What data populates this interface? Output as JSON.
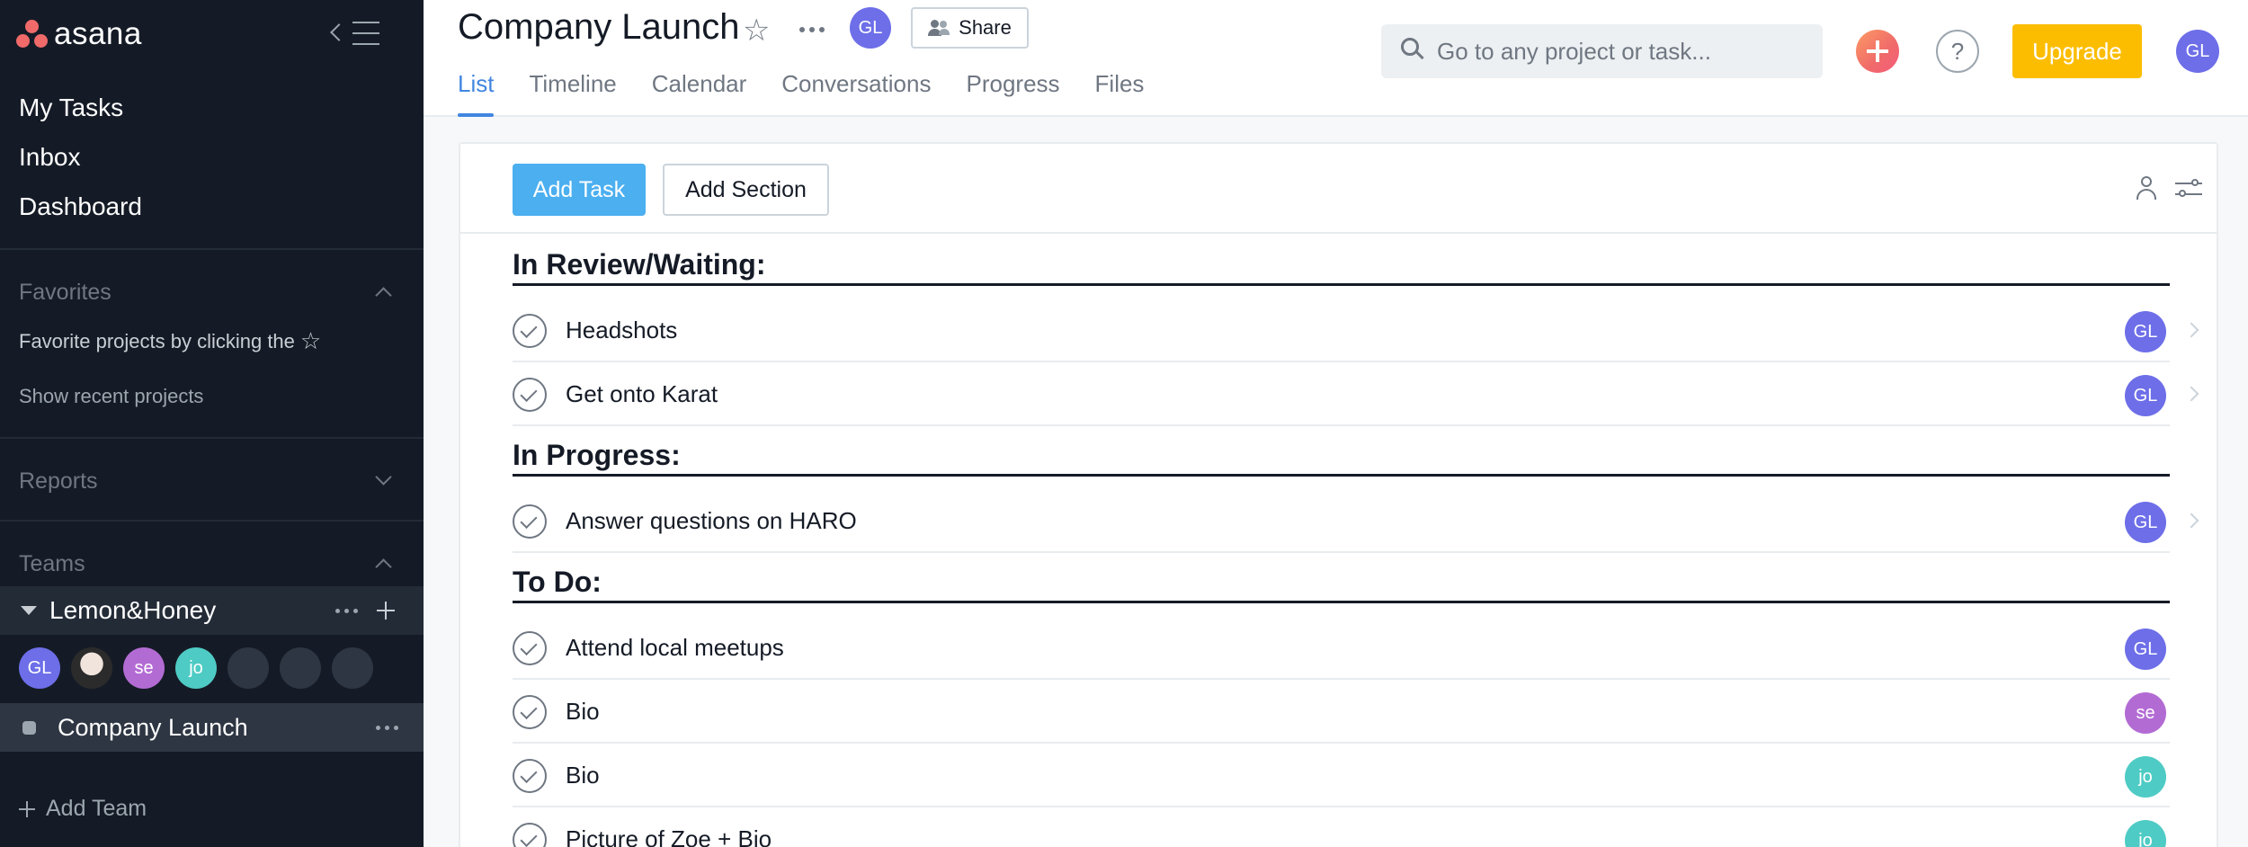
{
  "app": {
    "logo_text": "asana"
  },
  "colors": {
    "sidebar_bg": "#151b26",
    "accent_blue": "#4186e0",
    "add_task_blue": "#4baff0",
    "upgrade_yellow": "#fcbd01",
    "avatar_gl": "#6d6ee8",
    "avatar_se": "#b36bd4",
    "avatar_jo": "#4ecbc4"
  },
  "sidebar": {
    "nav": [
      "My Tasks",
      "Inbox",
      "Dashboard"
    ],
    "favorites": {
      "title": "Favorites",
      "hint": "Favorite projects by clicking the",
      "hint_icon": "star-icon",
      "recent_link": "Show recent projects"
    },
    "reports": {
      "title": "Reports"
    },
    "teams": {
      "title": "Teams",
      "team_name": "Lemon&Honey",
      "members": [
        {
          "initials": "GL",
          "color": "#6d6ee8"
        },
        {
          "initials": "",
          "type": "photo"
        },
        {
          "initials": "se",
          "color": "#b36bd4"
        },
        {
          "initials": "jo",
          "color": "#4ecbc4"
        },
        {
          "initials": "",
          "type": "empty"
        },
        {
          "initials": "",
          "type": "empty"
        },
        {
          "initials": "",
          "type": "empty"
        }
      ],
      "project": "Company Launch"
    },
    "add_team": "Add Team"
  },
  "header": {
    "project_title": "Company Launch",
    "owner_initials": "GL",
    "share_label": "Share",
    "tabs": [
      "List",
      "Timeline",
      "Calendar",
      "Conversations",
      "Progress",
      "Files"
    ],
    "active_tab": "List",
    "search_placeholder": "Go to any project or task...",
    "help_label": "?",
    "upgrade_label": "Upgrade",
    "user_initials": "GL"
  },
  "toolbar": {
    "add_task_label": "Add Task",
    "add_section_label": "Add Section"
  },
  "sections": [
    {
      "title": "In Review/Waiting:",
      "tasks": [
        {
          "name": "Headshots",
          "assignee": "GL",
          "color": "#6d6ee8"
        },
        {
          "name": "Get onto Karat",
          "assignee": "GL",
          "color": "#6d6ee8"
        }
      ]
    },
    {
      "title": "In Progress:",
      "tasks": [
        {
          "name": "Answer questions on HARO",
          "assignee": "GL",
          "color": "#6d6ee8"
        }
      ]
    },
    {
      "title": "To Do:",
      "tasks": [
        {
          "name": "Attend local meetups",
          "assignee": "GL",
          "color": "#6d6ee8"
        },
        {
          "name": "Bio",
          "assignee": "se",
          "color": "#b36bd4"
        },
        {
          "name": "Bio",
          "assignee": "jo",
          "color": "#4ecbc4"
        },
        {
          "name": "Picture of Zoe + Bio",
          "assignee": "jo",
          "color": "#4ecbc4"
        }
      ]
    }
  ]
}
